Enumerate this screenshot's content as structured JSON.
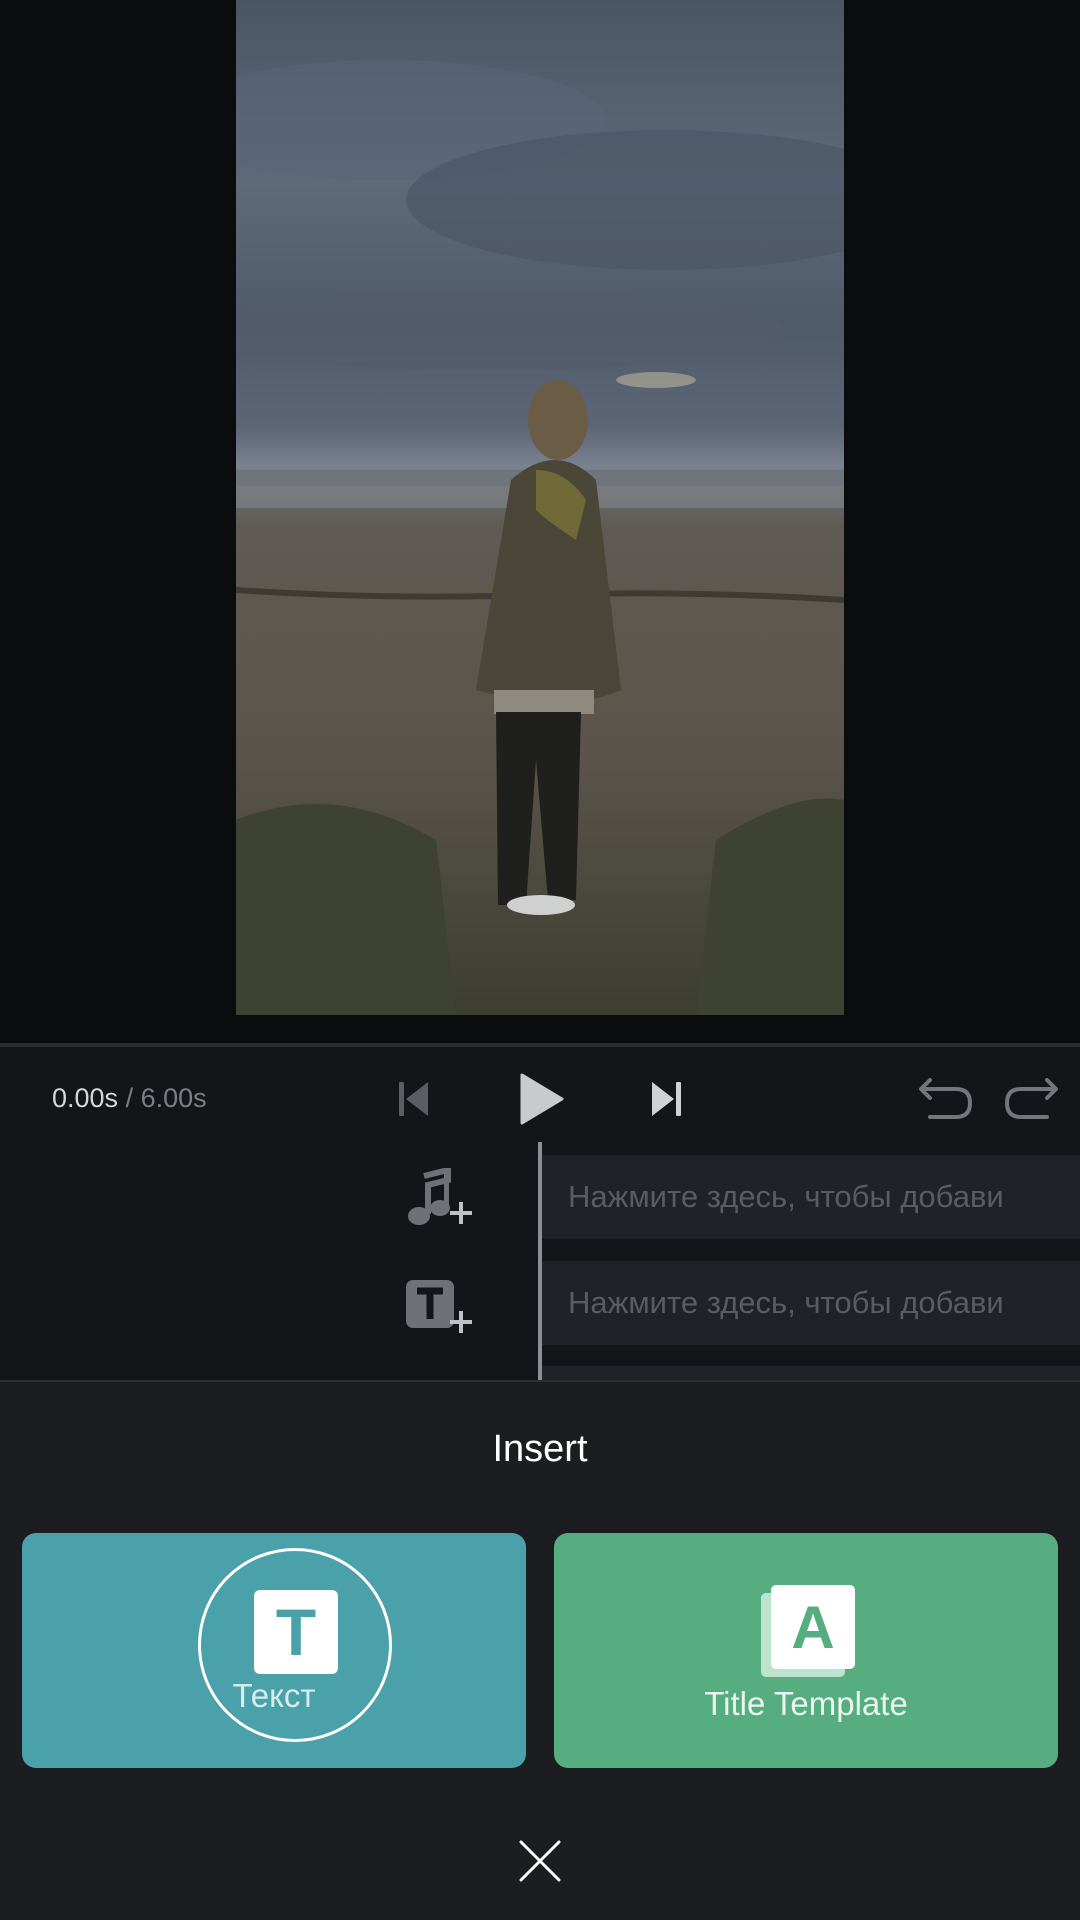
{
  "player": {
    "current_time": "0.00s",
    "separator": "/",
    "total_time": "6.00s"
  },
  "tracks": {
    "music_placeholder": "Нажмите здесь, чтобы добави",
    "text_placeholder": "Нажмите здесь, чтобы добави"
  },
  "insert_sheet": {
    "title": "Insert",
    "text_option_label": "Текст",
    "text_option_icon_letter": "T",
    "template_option_label": "Title Template",
    "template_option_icon_letter": "A"
  },
  "icons": {
    "prev": "skip-back-icon",
    "play": "play-icon",
    "next": "skip-forward-icon",
    "undo": "undo-icon",
    "redo": "redo-icon",
    "add_music": "music-add-icon",
    "add_text": "text-add-icon",
    "close": "close-icon"
  },
  "colors": {
    "text_card": "#4aa1aa",
    "template_card": "#56ae80",
    "sheet_bg": "#1c1d21"
  }
}
